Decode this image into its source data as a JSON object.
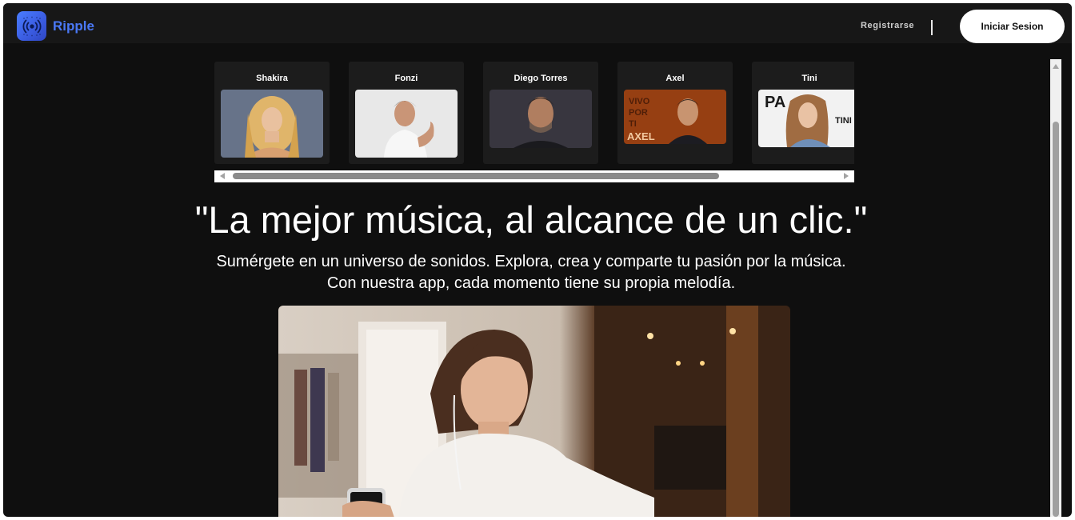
{
  "brand": {
    "name": "Ripple",
    "logo_icon": "radio-waves-icon",
    "accent": "#4a78f5"
  },
  "nav": {
    "register_label": "Registrarse",
    "login_label": "Iniciar Sesion"
  },
  "artists": [
    {
      "name": "Shakira",
      "photo_icon": "artist-photo"
    },
    {
      "name": "Fonzi",
      "photo_icon": "artist-photo"
    },
    {
      "name": "Diego Torres",
      "photo_icon": "artist-photo"
    },
    {
      "name": "Axel",
      "photo_icon": "artist-photo"
    },
    {
      "name": "Tini",
      "photo_icon": "artist-photo"
    }
  ],
  "hero": {
    "headline": "\"La mejor música, al alcance de un clic.\"",
    "subtitle_line1": "Sumérgete en un universo de sonidos. Explora, crea y comparte tu pasión por la música.",
    "subtitle_line2": "Con nuestra app, cada momento tiene su propia melodía."
  },
  "colors": {
    "page_bg": "#0f0f0f",
    "header_bg": "#171717",
    "card_bg": "#1c1c1c",
    "button_bg": "#ffffff"
  }
}
